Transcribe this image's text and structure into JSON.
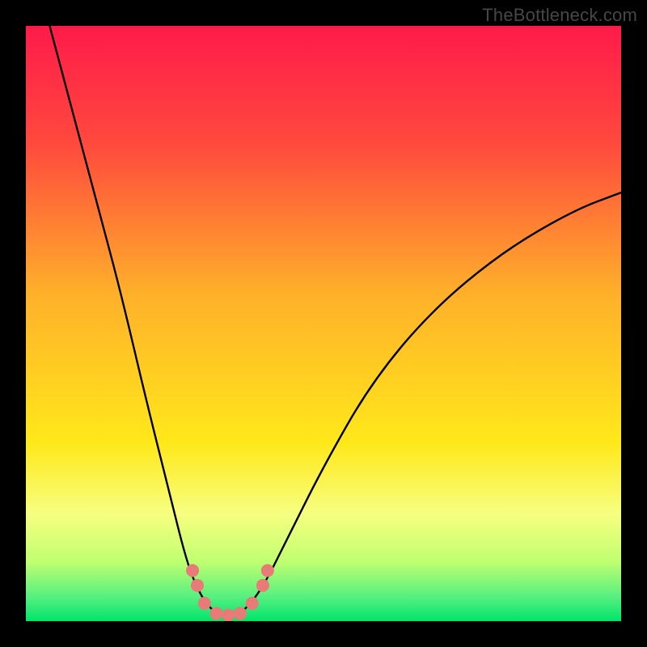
{
  "watermark": "TheBottleneck.com",
  "chart_data": {
    "type": "line",
    "title": "",
    "xlabel": "",
    "ylabel": "",
    "xlim": [
      0,
      100
    ],
    "ylim": [
      0,
      100
    ],
    "background_gradient_stops": [
      {
        "offset": 0,
        "color": "#ff1a4a"
      },
      {
        "offset": 0.2,
        "color": "#ff4a3d"
      },
      {
        "offset": 0.45,
        "color": "#ffb02a"
      },
      {
        "offset": 0.7,
        "color": "#ffe81a"
      },
      {
        "offset": 0.82,
        "color": "#f7ff80"
      },
      {
        "offset": 0.9,
        "color": "#c0ff70"
      },
      {
        "offset": 0.96,
        "color": "#55f080"
      },
      {
        "offset": 1.0,
        "color": "#00e46b"
      }
    ],
    "curve_points": [
      {
        "x": 4,
        "y": 100
      },
      {
        "x": 8,
        "y": 85
      },
      {
        "x": 12,
        "y": 70
      },
      {
        "x": 16,
        "y": 55
      },
      {
        "x": 20,
        "y": 38
      },
      {
        "x": 24,
        "y": 22
      },
      {
        "x": 27,
        "y": 10
      },
      {
        "x": 29,
        "y": 5
      },
      {
        "x": 31,
        "y": 2
      },
      {
        "x": 33,
        "y": 1
      },
      {
        "x": 35,
        "y": 1
      },
      {
        "x": 37,
        "y": 2
      },
      {
        "x": 40,
        "y": 6
      },
      {
        "x": 44,
        "y": 14
      },
      {
        "x": 50,
        "y": 26
      },
      {
        "x": 58,
        "y": 40
      },
      {
        "x": 68,
        "y": 52
      },
      {
        "x": 80,
        "y": 62
      },
      {
        "x": 92,
        "y": 69
      },
      {
        "x": 100,
        "y": 72
      }
    ],
    "marker_points": [
      {
        "x": 28,
        "y": 8.5
      },
      {
        "x": 28.8,
        "y": 6.0
      },
      {
        "x": 30.0,
        "y": 3.0
      },
      {
        "x": 32.0,
        "y": 1.3
      },
      {
        "x": 34.0,
        "y": 1.0
      },
      {
        "x": 36.0,
        "y": 1.3
      },
      {
        "x": 38.0,
        "y": 3.0
      },
      {
        "x": 39.8,
        "y": 6.0
      },
      {
        "x": 40.6,
        "y": 8.5
      }
    ],
    "curve_color": "#000000",
    "marker_color": "#e87a78",
    "marker_radius": 8
  }
}
